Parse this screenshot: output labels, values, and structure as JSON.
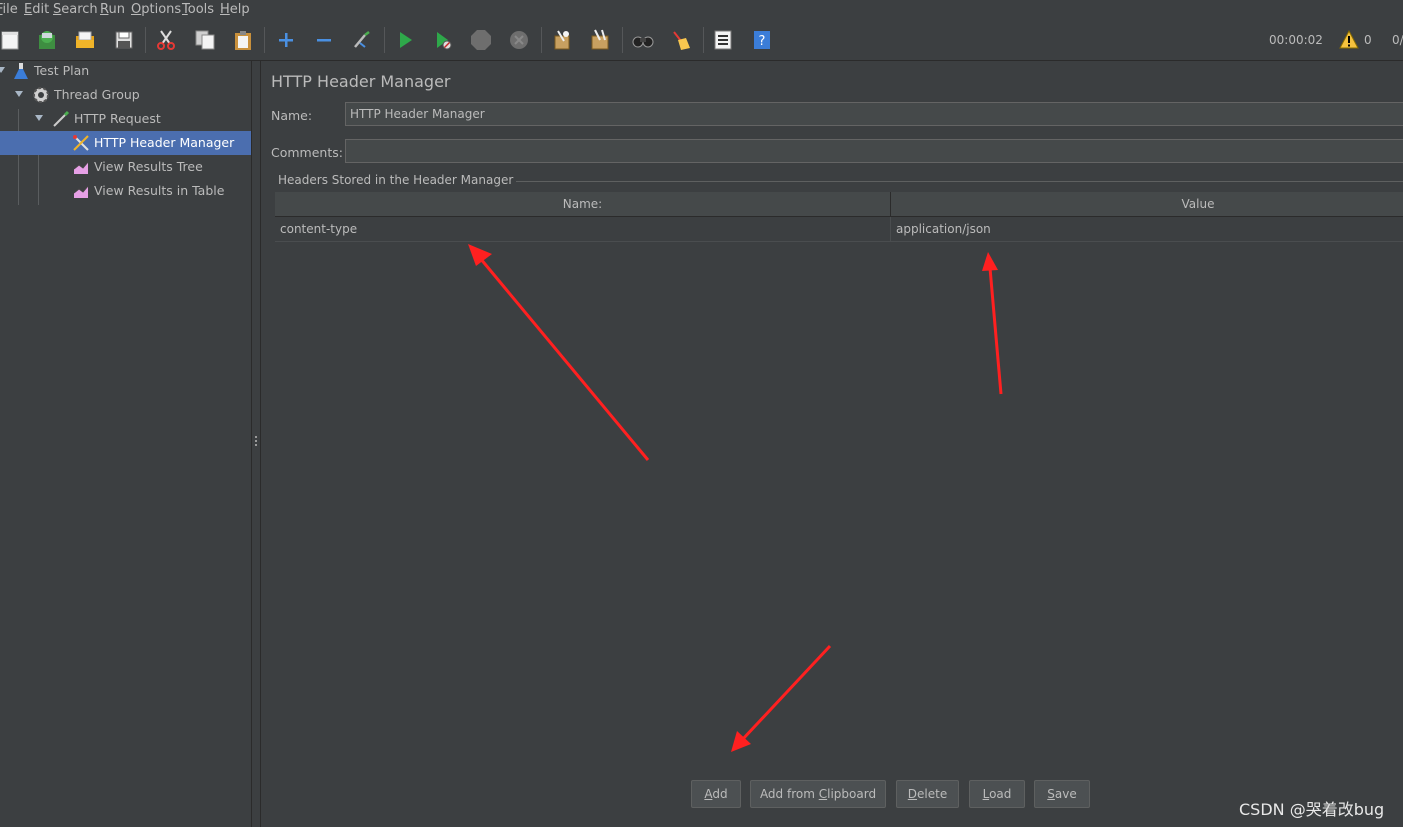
{
  "menubar": {
    "items": [
      "File",
      "Edit",
      "Search",
      "Run",
      "Options",
      "Tools",
      "Help"
    ]
  },
  "toolbar": {
    "icons": [
      "new-icon",
      "templates-icon",
      "open-icon",
      "save-icon",
      "cut-icon",
      "copy-icon",
      "paste-icon",
      "expand-icon",
      "collapse-icon",
      "toggle-icon",
      "start-icon",
      "start-no-timers-icon",
      "stop-icon",
      "shutdown-icon",
      "clear-icon",
      "clear-all-icon",
      "search-icon",
      "reset-search-icon",
      "function-helper-icon",
      "help-icon"
    ],
    "timer": "00:00:02",
    "warning_count": "0",
    "thread_count": "0/"
  },
  "tree": {
    "items": [
      {
        "label": "Test Plan",
        "icon": "test-plan-icon"
      },
      {
        "label": "Thread Group",
        "icon": "gear-icon"
      },
      {
        "label": "HTTP Request",
        "icon": "pipette-icon"
      },
      {
        "label": "HTTP Header Manager",
        "icon": "tools-icon",
        "selected": true
      },
      {
        "label": "View Results Tree",
        "icon": "chart-icon"
      },
      {
        "label": "View Results in Table",
        "icon": "chart-icon"
      }
    ]
  },
  "panel": {
    "title": "HTTP Header Manager",
    "name_label": "Name:",
    "name_value": "HTTP Header Manager",
    "comments_label": "Comments:",
    "comments_value": "",
    "group_title": "Headers Stored in the Header Manager",
    "columns": [
      "Name:",
      "Value"
    ],
    "rows": [
      {
        "name": "content-type",
        "value": "application/json"
      }
    ]
  },
  "buttons": [
    {
      "label": "Add",
      "mnemonic": "A"
    },
    {
      "label": "Add from Clipboard",
      "mnemonic": "C"
    },
    {
      "label": "Delete",
      "mnemonic": "D"
    },
    {
      "label": "Load",
      "mnemonic": "L"
    },
    {
      "label": "Save",
      "mnemonic": "S"
    }
  ],
  "watermark": "CSDN @哭着改bug",
  "colors": {
    "background": "#3c3f41",
    "selection": "#4b6eaf",
    "annotation_arrow": "#ff2020"
  }
}
